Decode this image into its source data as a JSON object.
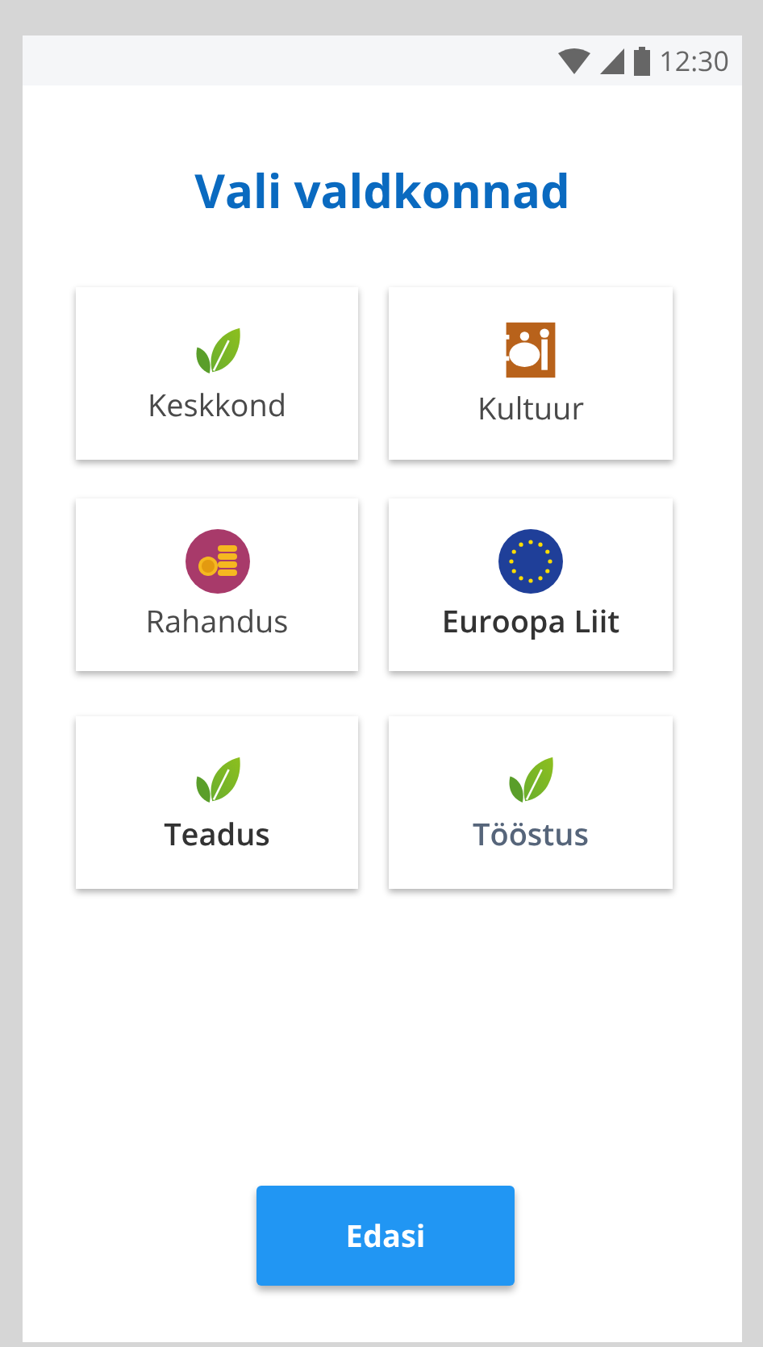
{
  "status_bar": {
    "time": "12:30"
  },
  "title": "Vali valdkonnad",
  "tiles": [
    {
      "label": "Keskkond",
      "kind": "leaf",
      "selected": false,
      "color": "#4a4a4a"
    },
    {
      "label": "Kultuur",
      "kind": "culture",
      "selected": false,
      "color": "#4a4a4a"
    },
    {
      "label": "Rahandus",
      "kind": "coins",
      "selected": false,
      "color": "#4a4a4a"
    },
    {
      "label": "Euroopa Liit",
      "kind": "flag",
      "selected": true,
      "color": "#333333"
    },
    {
      "label": "Teadus",
      "kind": "leaf",
      "selected": true,
      "color": "#333333"
    },
    {
      "label": "Tööstus",
      "kind": "leaf",
      "selected": true,
      "color": "#56657a"
    }
  ],
  "button": "Edasi"
}
